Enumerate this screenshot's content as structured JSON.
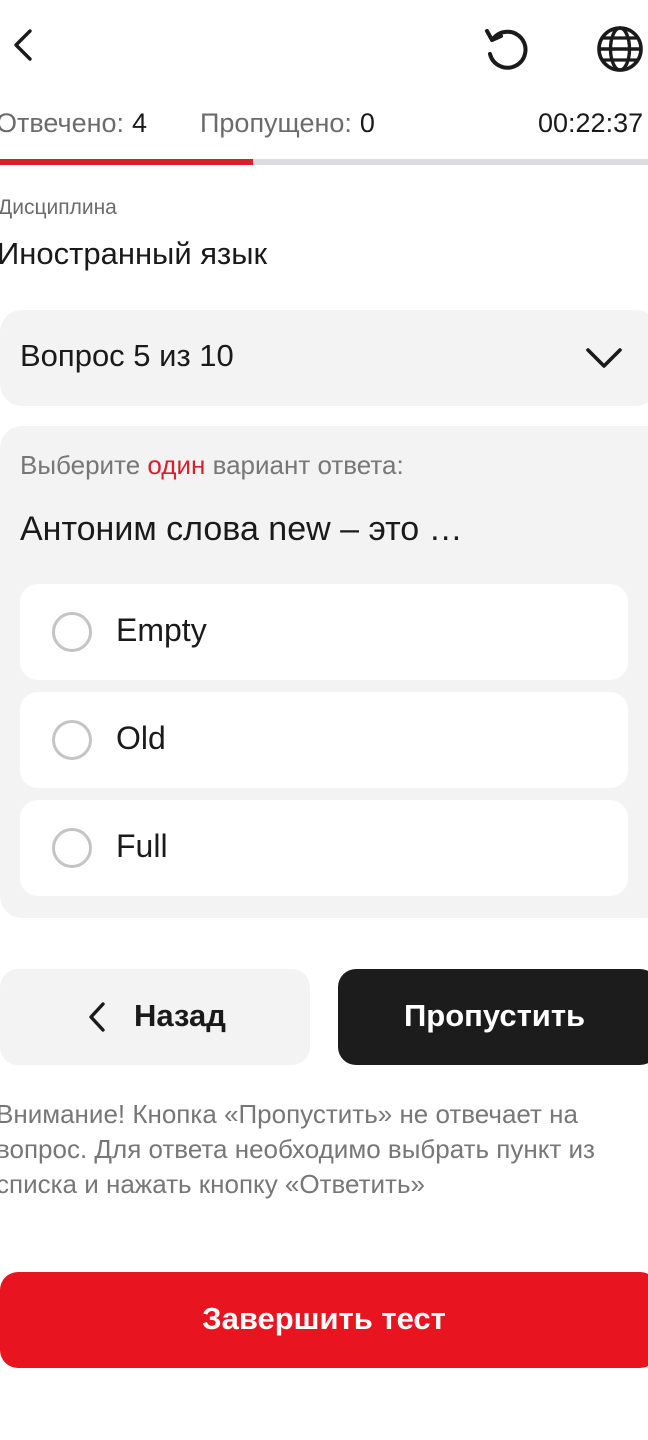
{
  "header": {
    "back_icon": "chevron-left-icon",
    "reset_icon": "rotate-ccw-icon",
    "language_icon": "globe-icon"
  },
  "stats": {
    "answered_label": "Отвечено:",
    "answered_value": "4",
    "skipped_label": "Пропущено:",
    "skipped_value": "0",
    "timer": "00:22:37"
  },
  "progress": {
    "fraction": 0.39,
    "fill_color": "#d8202a",
    "track_color": "#dcdce0"
  },
  "discipline": {
    "label": "Дисциплина",
    "value": "Иностранный язык"
  },
  "question_selector": {
    "label": "Вопрос 5 из 10",
    "chevron_icon": "chevron-down-icon"
  },
  "question": {
    "instruction_prefix": "Выберите",
    "instruction_accent": "один",
    "instruction_suffix": "вариант ответа:",
    "text": "Антоним слова new – это …",
    "options": [
      {
        "label": "Empty",
        "selected": false
      },
      {
        "label": "Old",
        "selected": false
      },
      {
        "label": "Full",
        "selected": false
      }
    ]
  },
  "actions": {
    "back_label": "Назад",
    "skip_label": "Пропустить",
    "finish_label": "Завершить тест"
  },
  "warning": "Внимание! Кнопка «Пропустить» не отвечает на вопрос. Для ответа необходимо выбрать пункт из списка и нажать кнопку «Ответить»",
  "colors": {
    "accent": "#d8202a",
    "finish_button": "#e8141f",
    "skip_button": "#1c1c1c",
    "surface": "#f3f3f3"
  }
}
